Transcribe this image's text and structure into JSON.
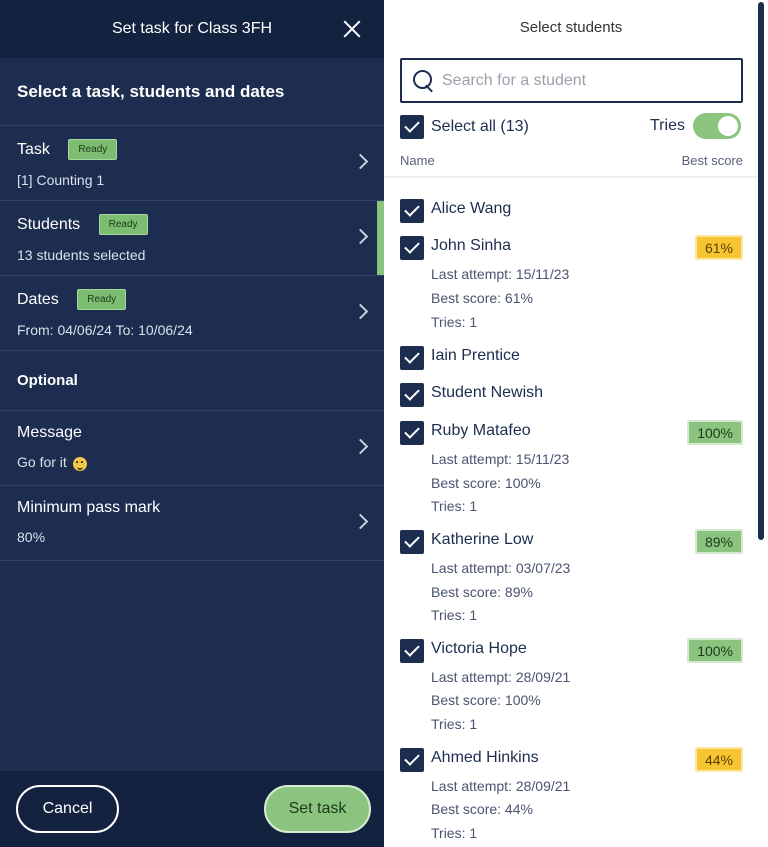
{
  "left": {
    "header_title": "Set task for Class 3FH",
    "section_title": "Select a task, students and dates",
    "rows": [
      {
        "label": "Task",
        "badge": "Ready",
        "sub": "[1] Counting 1"
      },
      {
        "label": "Students",
        "badge": "Ready",
        "sub": "13 students selected"
      },
      {
        "label": "Dates",
        "badge": "Ready",
        "sub": "From: 04/06/24 To: 10/06/24"
      }
    ],
    "optional_title": "Optional",
    "optional_rows": [
      {
        "label": "Message",
        "sub": "Go for it",
        "sub_icon": "grinning-face-emoji"
      },
      {
        "label": "Minimum pass mark",
        "sub": "80%"
      }
    ],
    "cancel_label": "Cancel",
    "set_task_label": "Set task"
  },
  "right": {
    "title": "Select students",
    "search_placeholder": "Search for a student",
    "select_all_label": "Select all (13)",
    "tries_label": "Tries",
    "tries_on": true,
    "col_name": "Name",
    "col_best": "Best score",
    "students": [
      {
        "name": "Alice Wang",
        "checked": true
      },
      {
        "name": "John Sinha",
        "checked": true,
        "score": "61%",
        "score_color": "#f7c531",
        "last_attempt": "Last attempt: 15/11/23",
        "best_score": "Best score: 61%",
        "tries": "Tries: 1"
      },
      {
        "name": "Iain Prentice",
        "checked": true
      },
      {
        "name": "Student Newish",
        "checked": true
      },
      {
        "name": "Ruby Matafeo",
        "checked": true,
        "score": "100%",
        "score_color": "#8bc47f",
        "last_attempt": "Last attempt: 15/11/23",
        "best_score": "Best score: 100%",
        "tries": "Tries: 1"
      },
      {
        "name": "Katherine Low",
        "checked": true,
        "score": "89%",
        "score_color": "#8bc47f",
        "last_attempt": "Last attempt: 03/07/23",
        "best_score": "Best score: 89%",
        "tries": "Tries: 1"
      },
      {
        "name": "Victoria Hope",
        "checked": true,
        "score": "100%",
        "score_color": "#8bc47f",
        "last_attempt": "Last attempt: 28/09/21",
        "best_score": "Best score: 100%",
        "tries": "Tries: 1"
      },
      {
        "name": "Ahmed Hinkins",
        "checked": true,
        "score": "44%",
        "score_color": "#f7c531",
        "last_attempt": "Last attempt: 28/09/21",
        "best_score": "Best score: 44%",
        "tries": "Tries: 1"
      }
    ]
  },
  "colors": {
    "navy": "#1c2d4f",
    "navy_dark": "#13223f",
    "green": "#8bc47f",
    "amber": "#f7c531"
  }
}
